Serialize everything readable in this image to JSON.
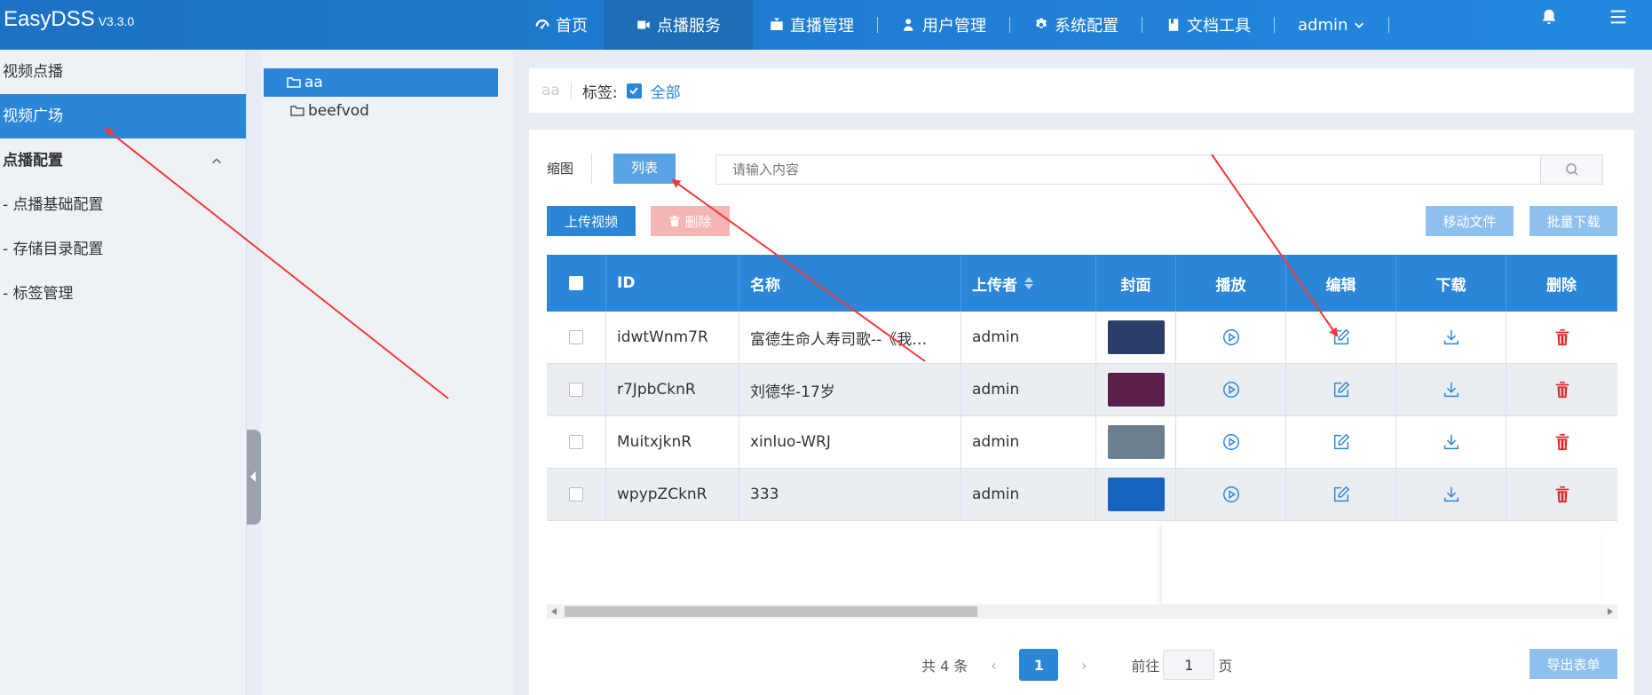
{
  "brand": {
    "name": "EasyDSS",
    "version": "V3.3.0"
  },
  "nav": {
    "home": "首页",
    "vod": "点播服务",
    "live": "直播管理",
    "users": "用户管理",
    "system": "系统配置",
    "docs": "文档工具",
    "admin": "admin"
  },
  "sidebar": {
    "items": [
      "视频点播",
      "视频广场"
    ],
    "group": "点播配置",
    "subs": [
      "- 点播基础配置",
      "- 存储目录配置",
      "- 标签管理"
    ]
  },
  "folders": [
    "aa",
    "beefvod"
  ],
  "tagbar": {
    "crumb": "aa",
    "label": "标签:",
    "all": "全部"
  },
  "toolbar": {
    "thumb": "缩图",
    "list": "列表",
    "search_placeholder": "请输入内容",
    "upload": "上传视频",
    "delete": "删除",
    "move": "移动文件",
    "batch_download": "批量下载"
  },
  "table": {
    "headers": {
      "id": "ID",
      "name": "名称",
      "uploader": "上传者",
      "cover": "封面",
      "play": "播放",
      "edit": "编辑",
      "download": "下载",
      "delete": "删除"
    },
    "rows": [
      {
        "id": "idwtWnm7R",
        "name": "富德生命人寿司歌--《我…",
        "uploader": "admin",
        "cover_color": "#2a3d66"
      },
      {
        "id": "r7JpbCknR",
        "name": "刘德华-17岁",
        "uploader": "admin",
        "cover_color": "#5a1e4a"
      },
      {
        "id": "MuitxjknR",
        "name": "xinluo-WRJ",
        "uploader": "admin",
        "cover_color": "#6b7f8e"
      },
      {
        "id": "wpypZCknR",
        "name": "333",
        "uploader": "admin",
        "cover_color": "#1565c0"
      }
    ]
  },
  "pager": {
    "total": "共 4 条",
    "current": "1",
    "goto": "前往",
    "goto_value": "1",
    "page_unit": "页",
    "export": "导出表单"
  },
  "colors": {
    "primary": "#2b86d8",
    "danger": "#e02b2b",
    "annotation": "#f03a3a"
  }
}
